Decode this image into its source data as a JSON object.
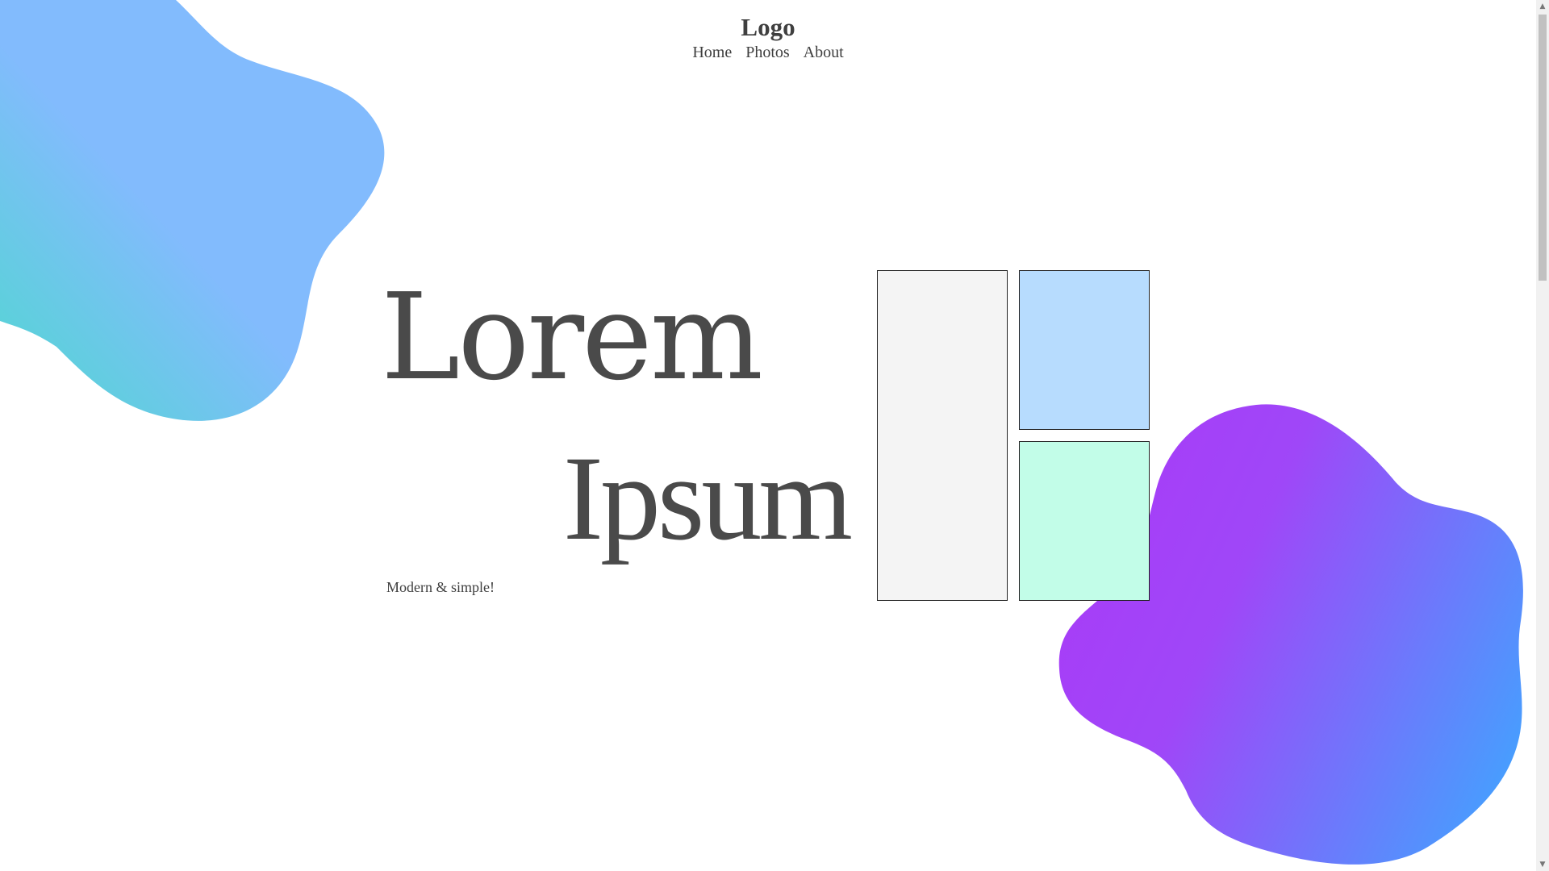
{
  "header": {
    "logo": "Logo",
    "nav": [
      "Home",
      "Photos",
      "About"
    ]
  },
  "hero": {
    "title_line1": "Lorem",
    "title_line2": "Ipsum",
    "tagline": "Modern & simple!"
  },
  "colors": {
    "text": "#4a4a4a",
    "blob_tl_start": "#4fd8cf",
    "blob_tl_end": "#82bbfd",
    "blob_br_start": "#a83cf7",
    "blob_br_end": "#479efe",
    "tile_tall": "#f4f4f4",
    "tile_top": "#b7dcfe",
    "tile_bottom": "#c2fde8"
  },
  "scrollbar": {
    "up_icon": "triangle-up-icon",
    "down_icon": "triangle-down-icon"
  }
}
